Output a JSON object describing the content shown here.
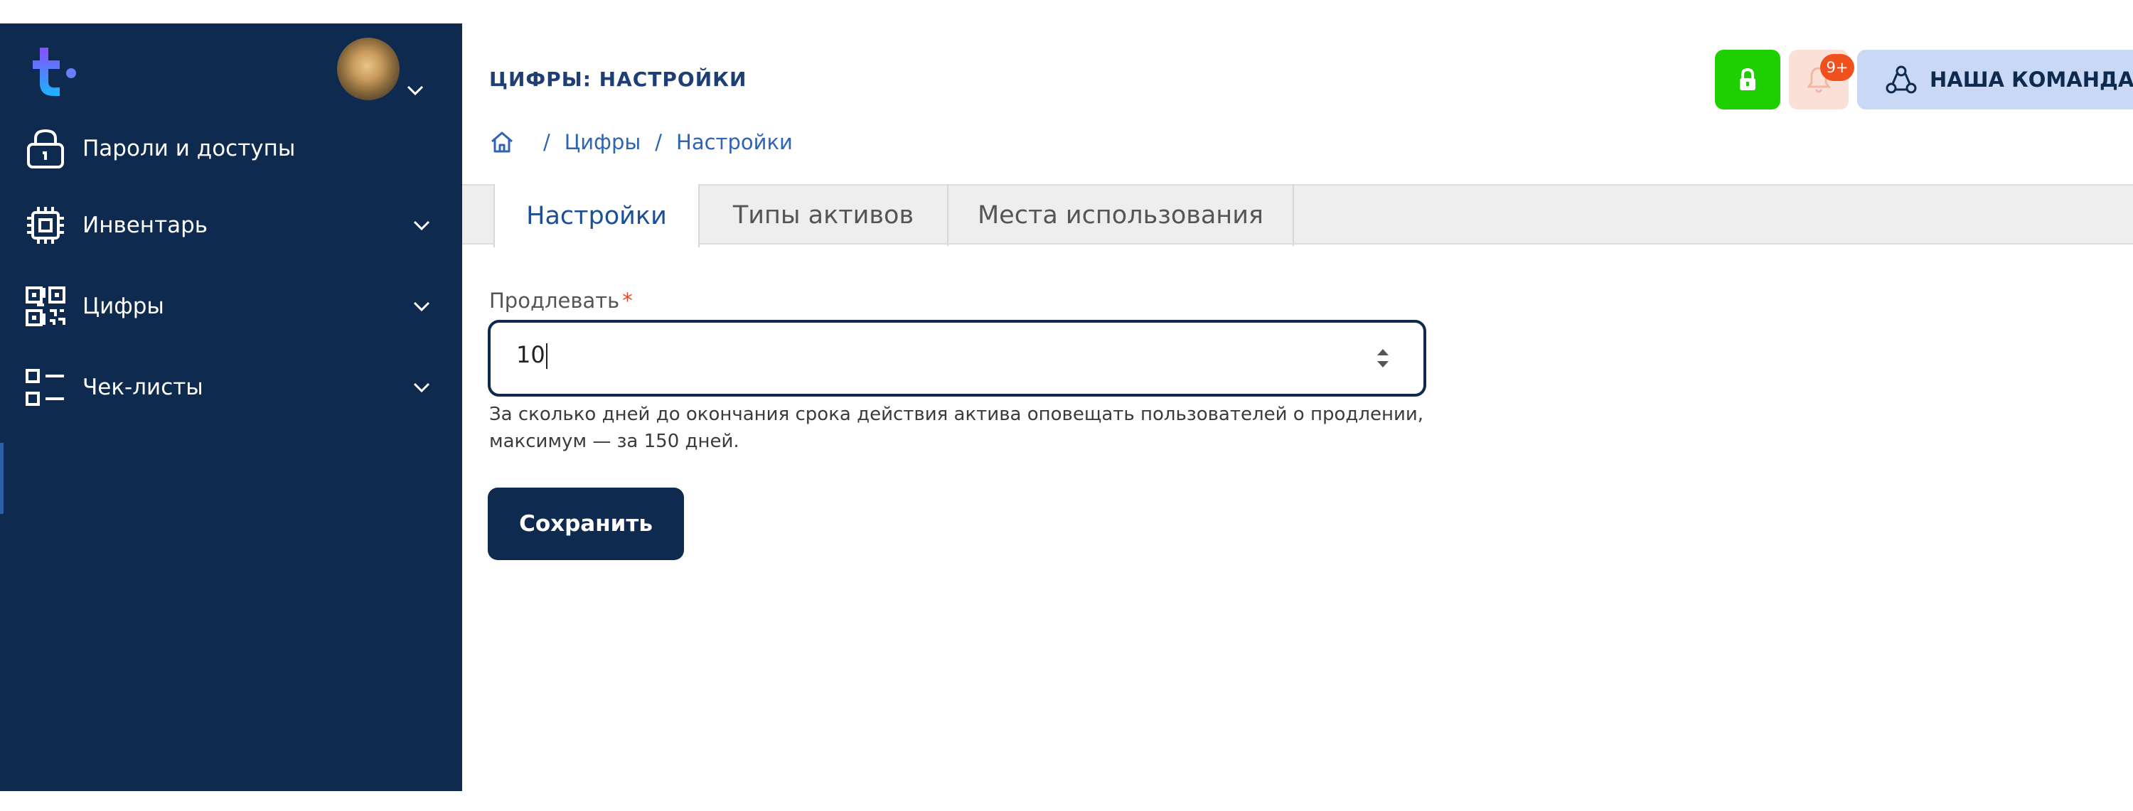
{
  "sidebar": {
    "logo_icon": "brand-logo-icon",
    "avatar_icon": "user-avatar",
    "items": [
      {
        "label": "Пароли и доступы",
        "icon": "lock-icon",
        "expandable": false
      },
      {
        "label": "Инвентарь",
        "icon": "chip-icon",
        "expandable": true
      },
      {
        "label": "Цифры",
        "icon": "qr-code-icon",
        "expandable": true
      },
      {
        "label": "Чек-листы",
        "icon": "checklist-icon",
        "expandable": true
      }
    ]
  },
  "header": {
    "title": "ЦИФРЫ: НАСТРОЙКИ",
    "breadcrumb": [
      "Цифры",
      "Настройки"
    ],
    "notification_badge": "9+",
    "team_button": "НАША КОМАНДА"
  },
  "tabs": [
    {
      "label": "Настройки",
      "active": true
    },
    {
      "label": "Типы активов",
      "active": false
    },
    {
      "label": "Места использования",
      "active": false
    }
  ],
  "form": {
    "field_label": "Продлевать",
    "required_mark": "*",
    "value": "10",
    "help_text": "За сколько дней до окончания срока действия актива оповещать пользователей о продлении, максимум — за 150 дней.",
    "save_label": "Сохранить"
  },
  "colors": {
    "sidebar_bg": "#0f2a4f",
    "accent_blue": "#2e64b5",
    "lock_button": "#1fd000",
    "badge": "#f0501e",
    "team_button": "#c8d8f5"
  }
}
